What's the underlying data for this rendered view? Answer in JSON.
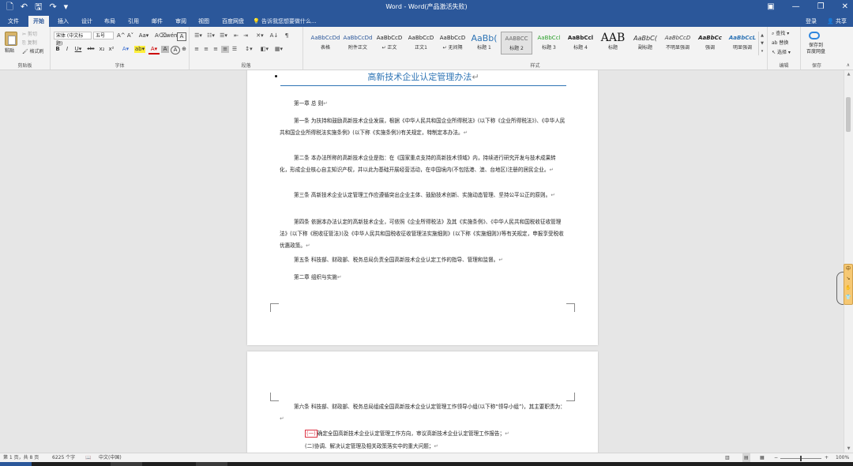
{
  "titlebar": {
    "title": "Word - Word(产品激活失败)",
    "qat": {
      "new": "🗋",
      "undo": "↶",
      "save": "🖫",
      "redo": "↷",
      "more": "▾"
    },
    "controls": {
      "ribbon_opts": "▣",
      "minimize": "—",
      "restore": "❐",
      "close": "✕"
    }
  },
  "tabs": [
    "文件",
    "开始",
    "插入",
    "设计",
    "布局",
    "引用",
    "邮件",
    "审阅",
    "视图",
    "百度网盘"
  ],
  "active_tab": "开始",
  "tell_me": "告诉我您想要做什么...",
  "signin": "登录",
  "share": "共享",
  "ribbon": {
    "clipboard": {
      "paste": "粘贴",
      "cut": "剪切",
      "copy": "复制",
      "format_painter": "格式刷",
      "label": "剪贴板"
    },
    "font": {
      "font_name": "宋体 (中文标题)",
      "font_size": "五号",
      "label": "字体",
      "row1": [
        "A^",
        "A˅",
        "Aa▾",
        "A⌫",
        "wén",
        "A"
      ],
      "row2": [
        "B",
        "I",
        "U▾",
        "abc",
        "x₂",
        "x²",
        "A▾",
        "ab▾",
        "A▾",
        "A",
        "A",
        "⊕"
      ]
    },
    "paragraph": {
      "label": "段落",
      "row1": [
        "☰▾",
        "☷▾",
        "☰▾",
        "⇤",
        "⇥",
        "✕▾",
        "A↓",
        "¶"
      ],
      "row2": [
        "≡",
        "≡",
        "≡",
        "≡",
        "☰",
        "↕▾",
        "◧▾",
        "▦▾"
      ]
    },
    "styles": {
      "label": "样式",
      "items": [
        {
          "preview": "AaBbCcDd",
          "name": "表格"
        },
        {
          "preview": "AaBbCcDd",
          "name": "附件正文"
        },
        {
          "preview": "AaBbCcD",
          "name": "↵ 正文"
        },
        {
          "preview": "AaBbCcD",
          "name": "正文1"
        },
        {
          "preview": "AaBbCcD",
          "name": "↵ 无间隔"
        },
        {
          "preview": "AaBb(",
          "name": "标题 1"
        },
        {
          "preview": "AABBCC",
          "name": "标题 2"
        },
        {
          "preview": "AaBbCcl",
          "name": "标题 3"
        },
        {
          "preview": "AaBbCcl",
          "name": "标题 4"
        },
        {
          "preview": "AAB",
          "name": "标题"
        },
        {
          "preview": "AaBbC(",
          "name": "副标题"
        },
        {
          "preview": "AaBbCcD",
          "name": "不明显强调"
        },
        {
          "preview": "AaBbCc",
          "name": "强调"
        },
        {
          "preview": "AaBbCcL",
          "name": "明显强调"
        }
      ]
    },
    "editing": {
      "find": "查找",
      "replace": "替换",
      "select": "选择",
      "label": "编辑"
    },
    "save": {
      "line1": "保存到",
      "line2": "百度网盘",
      "label": "保存"
    }
  },
  "document": {
    "title": "高新技术企业认定管理办法",
    "paragraphs": [
      "第一章 总 则",
      "第一条 为扶持和鼓励高新技术企业发展，根据《中华人民共和国企业所得税法》(以下称《企业所得税法》)、《中华人民共和国企业所得税法实施条例》(以下称《实施条例》)有关规定，特制定本办法。",
      "第二条 本办法所称的高新技术企业是指：在《国家重点支持的高新技术领域》内，持续进行研究开发与技术成果转化，形成企业核心自主知识产权，并以此为基础开展经营活动，在中国境内(不包括港、澳、台地区)注册的居民企业。",
      "第三条 高新技术企业认定管理工作应遵循突出企业主体、鼓励技术创新、实施动态管理、坚持公平公正的原则。",
      "第四条 依据本办法认定的高新技术企业，可依照《企业所得税法》及其《实施条例》、《中华人民共和国税收征收管理法》(以下称《税收征管法》)及《中华人民共和国税收征收管理法实施细则》(以下称《实施细则》)等有关规定，申报享受税收优惠政策。",
      "第五条 科技部、财政部、税务总局负责全国高新技术企业认定工作的指导、管理和监督。",
      "第二章 组织与实施"
    ],
    "page2_paragraphs": [
      "第六条 科技部、财政部、税务总局组成全国高新技术企业认定管理工作领导小组(以下称“领导小组”)，其主要职责为："
    ],
    "items": [
      {
        "num": "(一)",
        "text": "确定全国高新技术企业认定管理工作方向，审议高新技术企业认定管理工作报告；"
      },
      {
        "num": "",
        "text": "(二)协调、解决认定管理及相关政策落实中的重大问题；"
      }
    ],
    "para_mark": "↵"
  },
  "side_widget": [
    "中",
    "↘",
    "✋",
    "👕"
  ],
  "status": {
    "page": "第 1 页，共 8 页",
    "words": "6225 个字",
    "lang": "中文(中国)",
    "zoom": "100%",
    "zoom_minus": "−",
    "zoom_plus": "+"
  }
}
